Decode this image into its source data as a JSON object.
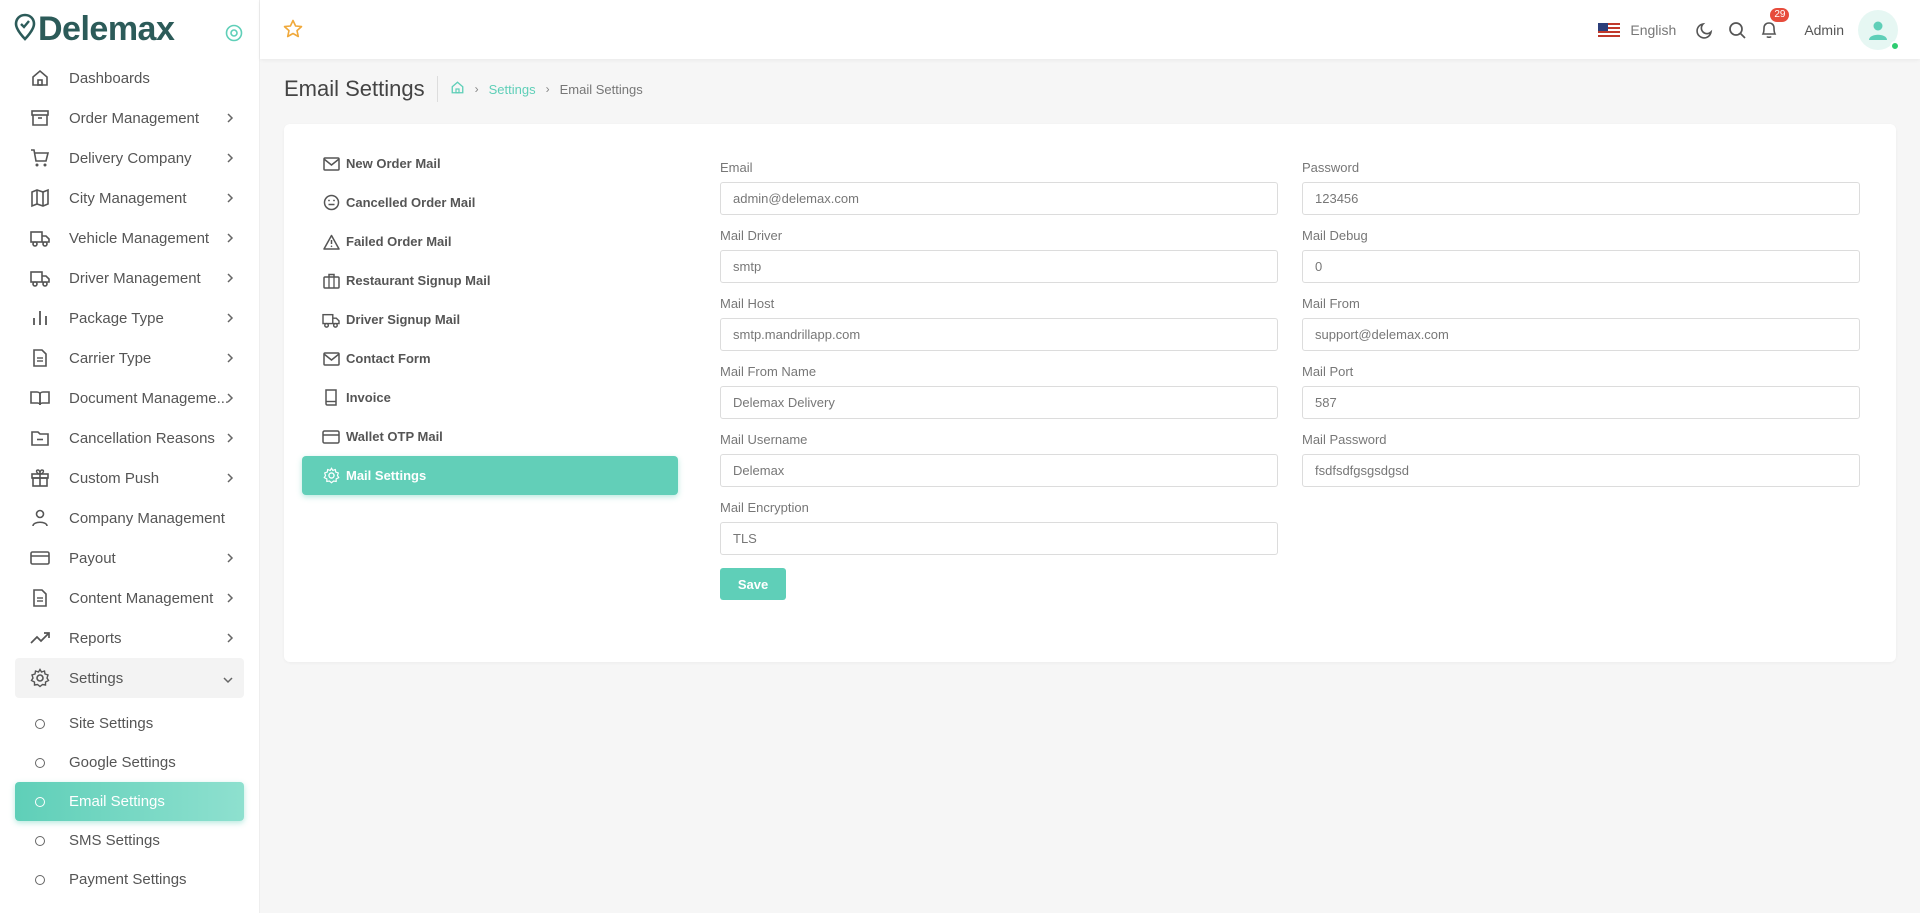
{
  "brand": {
    "name": "Delemax"
  },
  "sidebar": {
    "items": [
      {
        "label": "Dashboards",
        "icon": "home-icon",
        "chevron": false
      },
      {
        "label": "Order Management",
        "icon": "archive-icon",
        "chevron": true
      },
      {
        "label": "Delivery Company",
        "icon": "cart-icon",
        "chevron": true
      },
      {
        "label": "City Management",
        "icon": "map-icon",
        "chevron": true
      },
      {
        "label": "Vehicle Management",
        "icon": "truck-icon",
        "chevron": true
      },
      {
        "label": "Driver Management",
        "icon": "truck-icon",
        "chevron": true
      },
      {
        "label": "Package Type",
        "icon": "bar-chart-icon",
        "chevron": true
      },
      {
        "label": "Carrier Type",
        "icon": "file-text-icon",
        "chevron": true
      },
      {
        "label": "Document Manageme...",
        "icon": "book-open-icon",
        "chevron": true
      },
      {
        "label": "Cancellation Reasons",
        "icon": "folder-minus-icon",
        "chevron": true
      },
      {
        "label": "Custom Push",
        "icon": "gift-icon",
        "chevron": true
      },
      {
        "label": "Company Management",
        "icon": "user-icon",
        "chevron": false
      },
      {
        "label": "Payout",
        "icon": "credit-card-icon",
        "chevron": true
      },
      {
        "label": "Content Management",
        "icon": "file-text-icon",
        "chevron": true
      },
      {
        "label": "Reports",
        "icon": "trending-up-icon",
        "chevron": true
      },
      {
        "label": "Settings",
        "icon": "gear-icon",
        "chevron": true
      }
    ],
    "sub_items": [
      {
        "label": "Site Settings"
      },
      {
        "label": "Google Settings"
      },
      {
        "label": "Email Settings"
      },
      {
        "label": "SMS Settings"
      },
      {
        "label": "Payment Settings"
      }
    ]
  },
  "header": {
    "language": "English",
    "notification_count": "29",
    "user": "Admin"
  },
  "page": {
    "title": "Email Settings",
    "breadcrumb": {
      "link": "Settings",
      "current": "Email Settings"
    }
  },
  "tabs": [
    {
      "label": "New Order Mail",
      "icon": "mail-icon"
    },
    {
      "label": "Cancelled Order Mail",
      "icon": "smile-icon"
    },
    {
      "label": "Failed Order Mail",
      "icon": "alert-triangle-icon"
    },
    {
      "label": "Restaurant Signup Mail",
      "icon": "briefcase-icon"
    },
    {
      "label": "Driver Signup Mail",
      "icon": "truck-icon"
    },
    {
      "label": "Contact Form",
      "icon": "mail-icon"
    },
    {
      "label": "Invoice",
      "icon": "book-icon"
    },
    {
      "label": "Wallet OTP Mail",
      "icon": "credit-card-icon"
    },
    {
      "label": "Mail Settings",
      "icon": "gear-icon"
    }
  ],
  "form": {
    "email": {
      "label": "Email",
      "value": "admin@delemax.com"
    },
    "password": {
      "label": "Password",
      "value": "123456"
    },
    "mail_driver": {
      "label": "Mail Driver",
      "value": "smtp"
    },
    "mail_debug": {
      "label": "Mail Debug",
      "value": "0"
    },
    "mail_host": {
      "label": "Mail Host",
      "value": "smtp.mandrillapp.com"
    },
    "mail_from": {
      "label": "Mail From",
      "value": "support@delemax.com"
    },
    "mail_from_name": {
      "label": "Mail From Name",
      "value": "Delemax Delivery"
    },
    "mail_port": {
      "label": "Mail Port",
      "value": "587"
    },
    "mail_username": {
      "label": "Mail Username",
      "value": "Delemax"
    },
    "mail_password": {
      "label": "Mail Password",
      "value": "fsdfsdfgsgsdgsd"
    },
    "mail_encryption": {
      "label": "Mail Encryption",
      "value": "TLS"
    },
    "save_label": "Save"
  },
  "colors": {
    "accent": "#5fcfb8",
    "brand": "#2c5b59",
    "badge": "#e74c3c",
    "star": "#f0a93b"
  }
}
